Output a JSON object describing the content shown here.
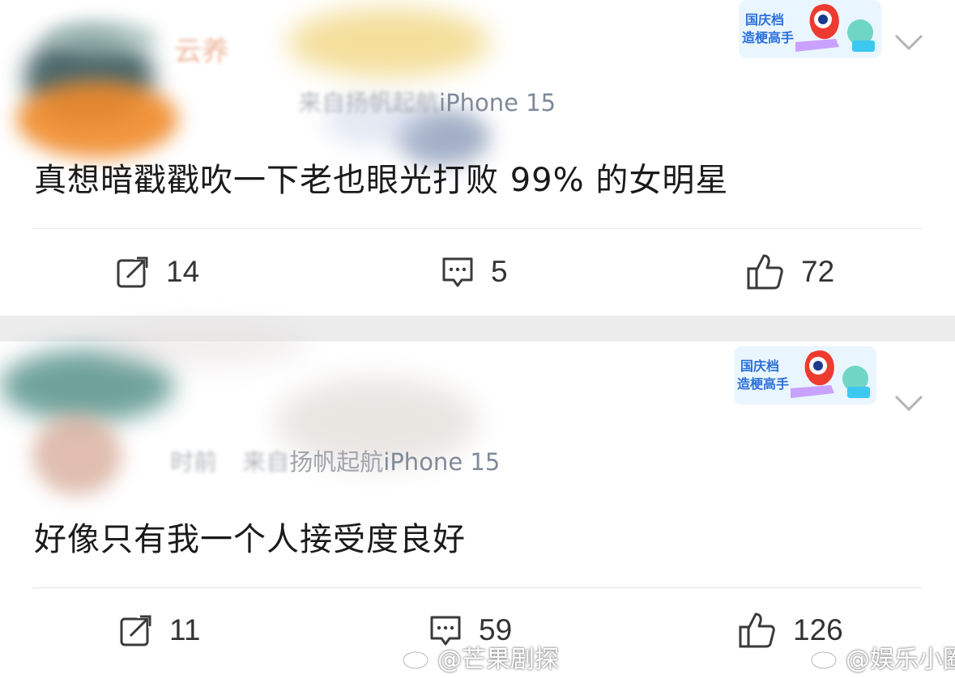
{
  "posts": [
    {
      "username": "云养",
      "meta_hidden": "来自",
      "source": "扬帆起航",
      "device": "iPhone 15",
      "content": "真想暗戳戳吹一下老也眼光打败 99% 的女明星",
      "badge": {
        "line1": "国庆档",
        "line2": "造梗高手"
      },
      "actions": {
        "repost": "14",
        "comment": "5",
        "like": "72"
      }
    },
    {
      "meta_hidden": "时前",
      "meta_hidden2": "来自",
      "source": "扬帆起航",
      "device": "iPhone 15",
      "content": "好像只有我一个人接受度良好",
      "badge": {
        "line1": "国庆档",
        "line2": "造梗高手"
      },
      "actions": {
        "repost": "11",
        "comment": "59",
        "like": "126"
      }
    }
  ],
  "watermarks": [
    "@芒果剧探",
    "@娱乐小圈"
  ],
  "icons": [
    "repost-icon",
    "comment-icon",
    "like-icon",
    "chevron-down-icon",
    "weibo-logo-icon"
  ],
  "colors": {
    "meta": "#a0a4ab",
    "device": "#7f8a99",
    "text": "#1a1a1a",
    "badge_blue": "#2d6fd8",
    "gap": "#ececec"
  }
}
